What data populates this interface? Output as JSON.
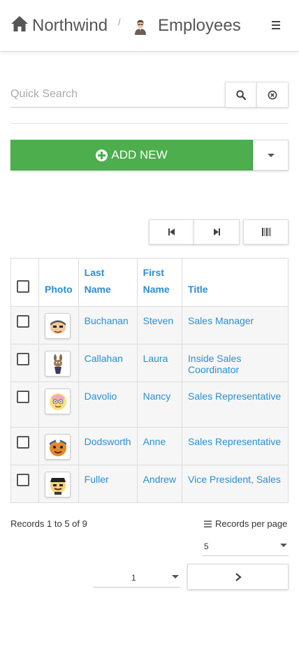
{
  "header": {
    "brand": "Northwind",
    "separator": "/",
    "page_title": "Employees",
    "icons": [
      "home-icon",
      "employee-icon",
      "hamburger-menu-icon"
    ]
  },
  "search": {
    "placeholder": "Quick Search",
    "value": "",
    "icons": [
      "search-icon",
      "clear-icon"
    ]
  },
  "toolbar": {
    "add_new_label": "ADD NEW",
    "accent_color": "#4cae4c"
  },
  "pager_buttons": [
    "first-page-icon",
    "last-page-icon",
    "columns-icon"
  ],
  "table": {
    "headers": {
      "photo": "Photo",
      "last_name": "Last Name",
      "first_name": "First Name",
      "title": "Title"
    },
    "rows": [
      {
        "last_name": "Buchanan",
        "first_name": "Steven",
        "title": "Sales Manager"
      },
      {
        "last_name": "Callahan",
        "first_name": "Laura",
        "title": "Inside Sales Coordinator"
      },
      {
        "last_name": "Davolio",
        "first_name": "Nancy",
        "title": "Sales Representative"
      },
      {
        "last_name": "Dodsworth",
        "first_name": "Anne",
        "title": "Sales Representative"
      },
      {
        "last_name": "Fuller",
        "first_name": "Andrew",
        "title": "Vice President, Sales"
      }
    ],
    "link_color": "#2a8fd0"
  },
  "footer": {
    "records_info": "Records 1 to 5 of 9",
    "records_per_page_label": "Records per page",
    "records_per_page_value": "5",
    "page_value": "1"
  }
}
